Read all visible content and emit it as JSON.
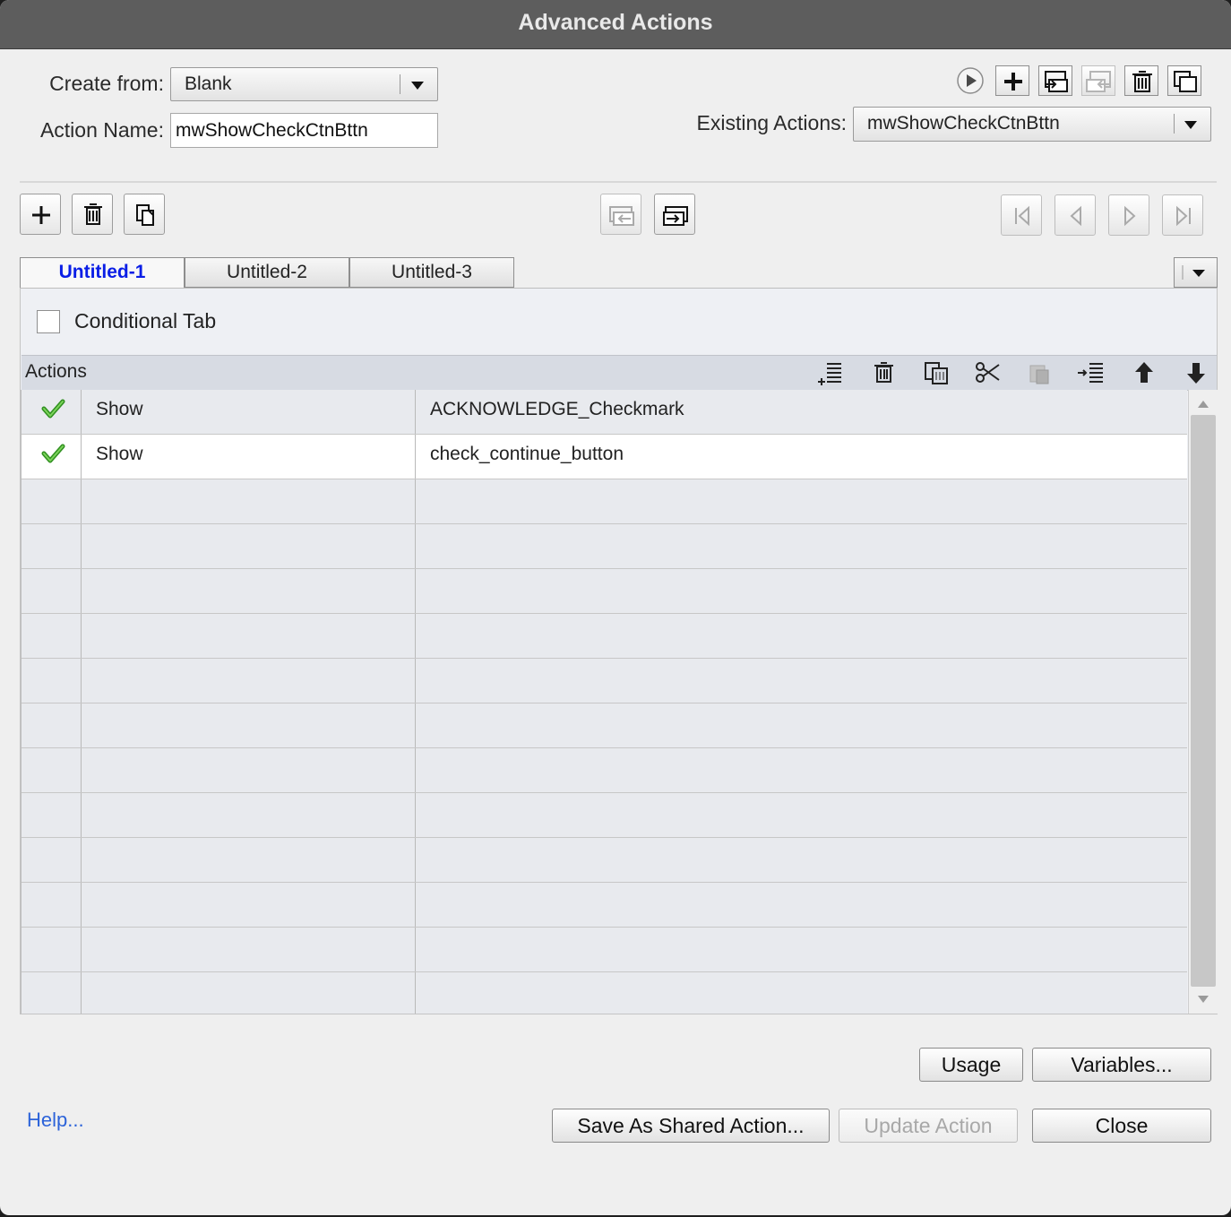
{
  "window": {
    "title": "Advanced Actions"
  },
  "form": {
    "create_from_label": "Create from:",
    "create_from_value": "Blank",
    "action_name_label": "Action Name:",
    "action_name_value": "mwShowCheckCtnBttn",
    "existing_actions_label": "Existing Actions:",
    "existing_actions_value": "mwShowCheckCtnBttn"
  },
  "tabs": [
    {
      "label": "Untitled-1",
      "active": true
    },
    {
      "label": "Untitled-2",
      "active": false
    },
    {
      "label": "Untitled-3",
      "active": false
    }
  ],
  "conditional_tab_label": "Conditional Tab",
  "actions_panel": {
    "title": "Actions",
    "rows": [
      {
        "status": "checkmark",
        "action": "Show",
        "target": "ACKNOWLEDGE_Checkmark"
      },
      {
        "status": "checkmark",
        "action": "Show",
        "target": "check_continue_button"
      }
    ]
  },
  "buttons": {
    "usage": "Usage",
    "variables": "Variables...",
    "save_shared": "Save As Shared Action...",
    "update_action": "Update Action",
    "close": "Close",
    "help": "Help..."
  },
  "colors": {
    "active_tab_text": "#0a1ee6",
    "check_green": "#3bb02b",
    "help_link": "#2c63d9"
  }
}
